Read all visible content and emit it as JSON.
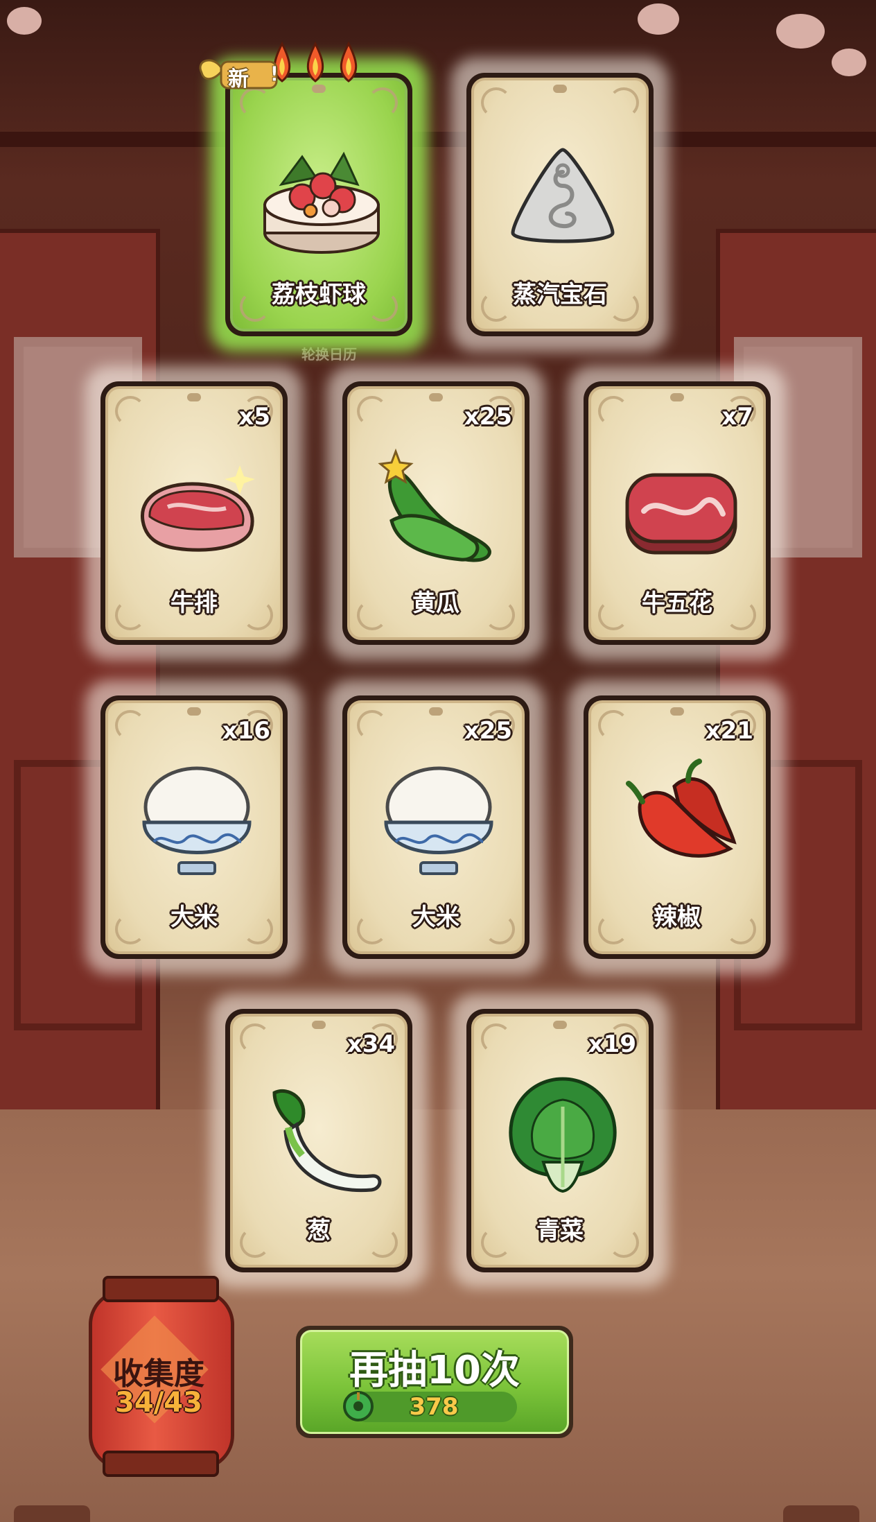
{
  "top_row": [
    {
      "name": "荔枝虾球",
      "qty": "",
      "icon": "lychee-shrimp-ball-icon",
      "highlight": "green",
      "is_new": true,
      "new_label": "新",
      "flames": 3
    },
    {
      "name": "蒸汽宝石",
      "qty": "",
      "icon": "steam-gem-icon"
    }
  ],
  "calendar_label": "轮换日历",
  "row2": [
    {
      "name": "牛排",
      "qty": "x5",
      "icon": "steak-icon"
    },
    {
      "name": "黄瓜",
      "qty": "x25",
      "icon": "cucumber-icon"
    },
    {
      "name": "牛五花",
      "qty": "x7",
      "icon": "beef-brisket-icon"
    }
  ],
  "row3": [
    {
      "name": "大米",
      "qty": "x16",
      "icon": "rice-bowl-icon"
    },
    {
      "name": "大米",
      "qty": "x25",
      "icon": "rice-bowl-icon"
    },
    {
      "name": "辣椒",
      "qty": "x21",
      "icon": "chili-pepper-icon"
    }
  ],
  "row4": [
    {
      "name": "葱",
      "qty": "x34",
      "icon": "scallion-icon"
    },
    {
      "name": "青菜",
      "qty": "x19",
      "icon": "bok-choy-icon"
    }
  ],
  "collection": {
    "title": "收集度",
    "count": "34/43"
  },
  "draw_button": {
    "label": "再抽10次",
    "cost": "378",
    "currency_icon": "jade-coin-icon"
  },
  "colors": {
    "highlight": "#9ad44e",
    "card_bg": "#eadbb4",
    "button_green": "#7cc43a",
    "lantern_red": "#e85a44",
    "cost_gold": "#f9c94a"
  }
}
